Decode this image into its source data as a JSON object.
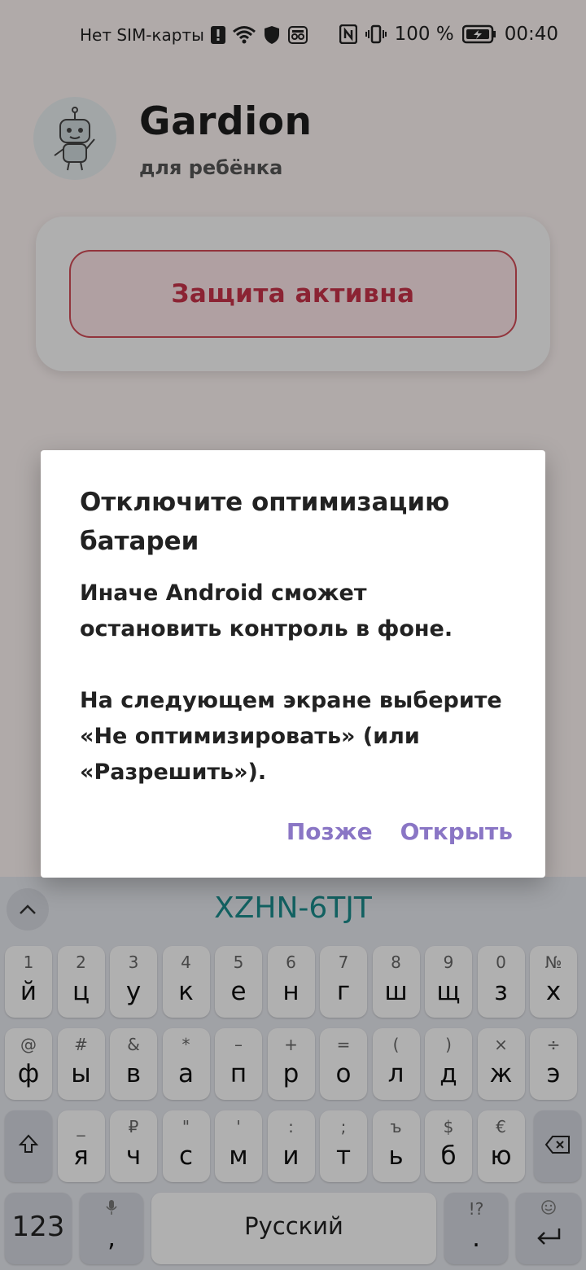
{
  "status_bar": {
    "carrier": "Нет SIM-карты",
    "battery": "100 %",
    "time": "00:40"
  },
  "app": {
    "title": "Gardion",
    "subtitle": "для ребёнка",
    "status_button": "Защита активна"
  },
  "dialog": {
    "title": "Отключите оптимизацию батареи",
    "body_1": "Иначе Android сможет\nостановить контроль в фоне.",
    "body_2": "На следующем экране выберите\n«Не оптимизировать» (или\n«Разрешить»).",
    "later_button": "Позже",
    "open_button": "Открыть"
  },
  "keyboard": {
    "suggestion": "XZHN-6TJT",
    "row1": [
      {
        "hint": "1",
        "key": "й"
      },
      {
        "hint": "2",
        "key": "ц"
      },
      {
        "hint": "3",
        "key": "у"
      },
      {
        "hint": "4",
        "key": "к"
      },
      {
        "hint": "5",
        "key": "е"
      },
      {
        "hint": "6",
        "key": "н"
      },
      {
        "hint": "7",
        "key": "г"
      },
      {
        "hint": "8",
        "key": "ш"
      },
      {
        "hint": "9",
        "key": "щ"
      },
      {
        "hint": "0",
        "key": "з"
      },
      {
        "hint": "№",
        "key": "х"
      }
    ],
    "row2": [
      {
        "hint": "@",
        "key": "ф"
      },
      {
        "hint": "#",
        "key": "ы"
      },
      {
        "hint": "&",
        "key": "в"
      },
      {
        "hint": "*",
        "key": "а"
      },
      {
        "hint": "–",
        "key": "п"
      },
      {
        "hint": "+",
        "key": "р"
      },
      {
        "hint": "=",
        "key": "о"
      },
      {
        "hint": "(",
        "key": "л"
      },
      {
        "hint": ")",
        "key": "д"
      },
      {
        "hint": "×",
        "key": "ж"
      },
      {
        "hint": "÷",
        "key": "э"
      }
    ],
    "row3": [
      {
        "hint": "_",
        "key": "я"
      },
      {
        "hint": "₽",
        "key": "ч"
      },
      {
        "hint": "\"",
        "key": "с"
      },
      {
        "hint": "'",
        "key": "м"
      },
      {
        "hint": ":",
        "key": "и"
      },
      {
        "hint": ";",
        "key": "т"
      },
      {
        "hint": "ъ",
        "key": "ь"
      },
      {
        "hint": "$",
        "key": "б"
      },
      {
        "hint": "€",
        "key": "ю"
      }
    ],
    "numbers_key": "123",
    "comma_key": ",",
    "space_key": "Русский",
    "period_key": ".",
    "period_hint": "!?"
  },
  "colors": {
    "accent_red": "#c7334a",
    "dialog_button": "#8a76c5",
    "suggestion_teal": "#1a8c8c"
  },
  "icons": [
    "warning-icon",
    "wifi-icon",
    "shield-icon",
    "incognito-icon",
    "nfc-icon",
    "vibrate-icon",
    "battery-charging-icon",
    "chevron-up-icon",
    "shift-icon",
    "backspace-icon",
    "microphone-icon",
    "emoji-icon",
    "enter-icon"
  ]
}
